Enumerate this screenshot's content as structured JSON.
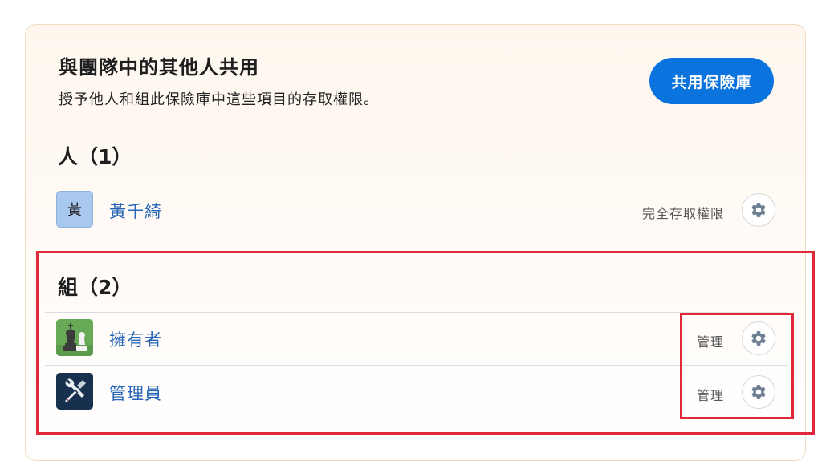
{
  "header": {
    "title": "與團隊中的其他人共用",
    "subtitle": "授予他人和組此保險庫中這些項目的存取權限。",
    "share_button_label": "共用保險庫"
  },
  "people": {
    "heading": "人（1）",
    "items": [
      {
        "avatar_text": "黃",
        "name": "黃千綺",
        "permission": "完全存取權限",
        "icon": "gear-icon"
      }
    ]
  },
  "groups": {
    "heading": "組（2）",
    "items": [
      {
        "avatar_icon": "chess-pieces-icon",
        "name": "擁有者",
        "permission": "管理",
        "icon": "gear-icon"
      },
      {
        "avatar_icon": "tools-icon",
        "name": "管理員",
        "permission": "管理",
        "icon": "gear-icon"
      }
    ]
  },
  "colors": {
    "accent": "#0b73de",
    "link": "#2665b5",
    "highlight": "#e0283b"
  }
}
